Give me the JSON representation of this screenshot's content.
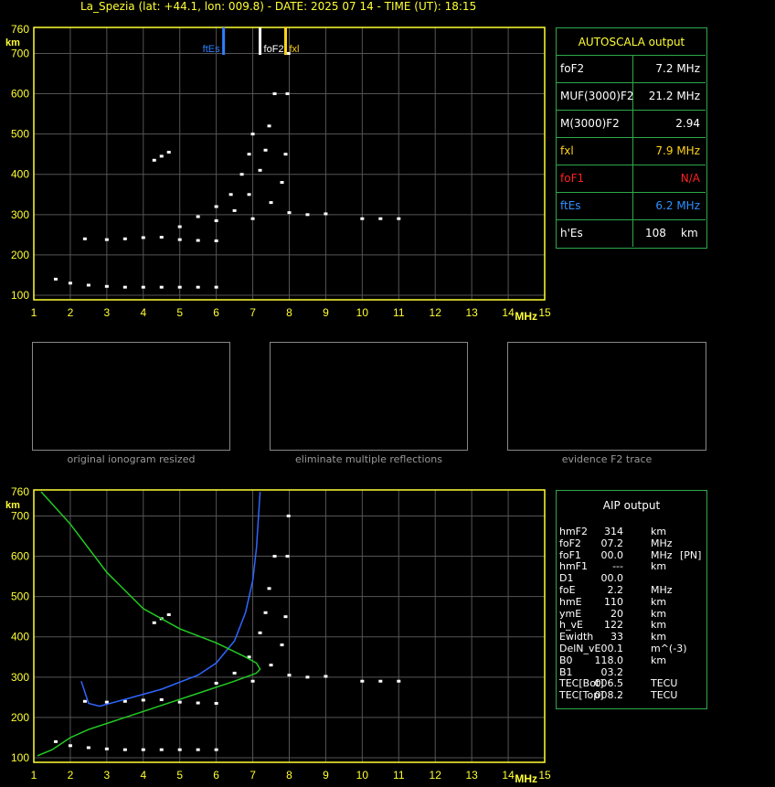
{
  "header": "La_Spezia (lat: +44.1, lon: 009.8) - DATE: 2025 07 14 - TIME (UT): 18:15",
  "chart_data": [
    {
      "type": "scatter",
      "title": "",
      "xlabel": "MHz",
      "ylabel": "km",
      "xlim": [
        1,
        15
      ],
      "ylim": [
        100,
        760
      ],
      "xticks": [
        1,
        2,
        3,
        4,
        5,
        6,
        7,
        8,
        9,
        10,
        11,
        12,
        13,
        14,
        15
      ],
      "yticks": [
        100,
        200,
        300,
        400,
        500,
        600,
        700,
        760
      ],
      "grid": true,
      "markers": [
        {
          "label": "ftEs",
          "x": 6.2,
          "color": "#2f7fff"
        },
        {
          "label": "foF2",
          "x": 7.2,
          "color": "#ffffff"
        },
        {
          "label": "fxl",
          "x": 7.9,
          "color": "#ffd21a"
        }
      ],
      "series": [
        {
          "points": [
            [
              1.6,
              140
            ],
            [
              2.0,
              130
            ],
            [
              2.5,
              125
            ],
            [
              3.0,
              122
            ],
            [
              3.5,
              120
            ],
            [
              4.0,
              120
            ],
            [
              4.5,
              120
            ],
            [
              5.0,
              120
            ],
            [
              5.5,
              120
            ],
            [
              6.0,
              120
            ]
          ]
        },
        {
          "points": [
            [
              2.4,
              240
            ],
            [
              3.0,
              238
            ],
            [
              3.5,
              240
            ],
            [
              4.0,
              243
            ],
            [
              4.5,
              244
            ],
            [
              5.0,
              238
            ],
            [
              5.5,
              236
            ],
            [
              6.0,
              235
            ]
          ]
        },
        {
          "points": [
            [
              4.3,
              435
            ],
            [
              4.5,
              445
            ],
            [
              4.7,
              455
            ]
          ]
        },
        {
          "points": [
            [
              5.0,
              270
            ],
            [
              5.5,
              295
            ],
            [
              6.0,
              320
            ],
            [
              6.4,
              350
            ],
            [
              6.7,
              400
            ],
            [
              6.9,
              450
            ],
            [
              7.0,
              500
            ]
          ]
        },
        {
          "points": [
            [
              6.0,
              285
            ],
            [
              6.5,
              310
            ],
            [
              6.9,
              350
            ],
            [
              7.2,
              410
            ],
            [
              7.35,
              460
            ],
            [
              7.45,
              520
            ],
            [
              7.6,
              600
            ]
          ]
        },
        {
          "points": [
            [
              7.0,
              290
            ],
            [
              7.5,
              330
            ],
            [
              7.8,
              380
            ],
            [
              7.9,
              450
            ],
            [
              7.95,
              600
            ],
            [
              7.98,
              700
            ]
          ]
        },
        {
          "points": [
            [
              8.0,
              305
            ],
            [
              8.5,
              300
            ],
            [
              9.0,
              302
            ],
            [
              10.0,
              290
            ],
            [
              10.5,
              290
            ],
            [
              11.0,
              290
            ]
          ]
        }
      ]
    },
    {
      "type": "scatter",
      "title": "",
      "xlabel": "MHz",
      "ylabel": "km",
      "xlim": [
        1,
        15
      ],
      "ylim": [
        100,
        760
      ],
      "xticks": [
        1,
        2,
        3,
        4,
        5,
        6,
        7,
        8,
        9,
        10,
        11,
        12,
        13,
        14,
        15
      ],
      "yticks": [
        100,
        200,
        300,
        400,
        500,
        600,
        700,
        760
      ],
      "grid": true,
      "series": [
        {
          "points": [
            [
              1.6,
              140
            ],
            [
              2.0,
              130
            ],
            [
              2.5,
              125
            ],
            [
              3.0,
              122
            ],
            [
              3.5,
              120
            ],
            [
              4.0,
              120
            ],
            [
              4.5,
              120
            ],
            [
              5.0,
              120
            ],
            [
              5.5,
              120
            ],
            [
              6.0,
              120
            ]
          ]
        },
        {
          "points": [
            [
              2.4,
              240
            ],
            [
              3.0,
              238
            ],
            [
              3.5,
              240
            ],
            [
              4.0,
              243
            ],
            [
              4.5,
              244
            ],
            [
              5.0,
              238
            ],
            [
              5.5,
              236
            ],
            [
              6.0,
              235
            ]
          ]
        },
        {
          "points": [
            [
              4.3,
              435
            ],
            [
              4.5,
              445
            ],
            [
              4.7,
              455
            ]
          ]
        },
        {
          "points": [
            [
              6.0,
              285
            ],
            [
              6.5,
              310
            ],
            [
              6.9,
              350
            ],
            [
              7.2,
              410
            ],
            [
              7.35,
              460
            ],
            [
              7.45,
              520
            ],
            [
              7.6,
              600
            ]
          ]
        },
        {
          "points": [
            [
              7.0,
              290
            ],
            [
              7.5,
              330
            ],
            [
              7.8,
              380
            ],
            [
              7.9,
              450
            ],
            [
              7.95,
              600
            ],
            [
              7.98,
              700
            ]
          ]
        },
        {
          "points": [
            [
              8.0,
              305
            ],
            [
              8.5,
              300
            ],
            [
              9.0,
              302
            ],
            [
              10.0,
              290
            ],
            [
              10.5,
              290
            ],
            [
              11.0,
              290
            ]
          ]
        },
        {
          "color": "#2f66ff",
          "points": [
            [
              2.3,
              290
            ],
            [
              2.5,
              235
            ],
            [
              2.8,
              228
            ],
            [
              3.5,
              245
            ],
            [
              4.5,
              270
            ],
            [
              5.5,
              305
            ],
            [
              6.0,
              335
            ],
            [
              6.5,
              390
            ],
            [
              6.8,
              460
            ],
            [
              7.0,
              540
            ],
            [
              7.1,
              620
            ],
            [
              7.2,
              760
            ]
          ]
        },
        {
          "color": "#22cc22",
          "points": [
            [
              1.1,
              105
            ],
            [
              1.5,
              120
            ],
            [
              2.0,
              150
            ],
            [
              2.5,
              170
            ],
            [
              3.5,
              200
            ],
            [
              4.5,
              230
            ],
            [
              5.5,
              260
            ],
            [
              6.5,
              290
            ],
            [
              7.1,
              310
            ],
            [
              7.2,
              320
            ],
            [
              7.1,
              335
            ],
            [
              6.8,
              350
            ],
            [
              6.0,
              385
            ],
            [
              5.0,
              420
            ],
            [
              4.0,
              470
            ],
            [
              3.0,
              560
            ],
            [
              2.0,
              680
            ],
            [
              1.2,
              760
            ]
          ]
        }
      ]
    }
  ],
  "thumbnails": [
    {
      "caption": "original ionogram resized"
    },
    {
      "caption": "eliminate multiple reflections"
    },
    {
      "caption": "evidence F2 trace"
    }
  ],
  "autoscala": {
    "title": "AUTOSCALA output",
    "rows": [
      {
        "label": "foF2",
        "value": "7.2 MHz",
        "color": "#ffffff"
      },
      {
        "label": "MUF(3000)F2",
        "value": "21.2 MHz",
        "color": "#ffffff"
      },
      {
        "label": "M(3000)F2",
        "value": "2.94",
        "color": "#ffffff"
      },
      {
        "label": "fxl",
        "value": "7.9 MHz",
        "color": "#ffd21a"
      },
      {
        "label": "foF1",
        "value": "N/A",
        "color": "#ff2020"
      },
      {
        "label": "ftEs",
        "value": "6.2 MHz",
        "color": "#2f8fff"
      },
      {
        "label": "h'Es",
        "value": "108",
        "unit": "km",
        "color": "#ffffff"
      }
    ]
  },
  "aip": {
    "title": "AIP output",
    "rows": [
      {
        "label": "hmF2",
        "value": "314",
        "unit": "km",
        "note": ""
      },
      {
        "label": "foF2",
        "value": "07.2",
        "unit": "MHz",
        "note": ""
      },
      {
        "label": "foF1",
        "value": "00.0",
        "unit": "MHz",
        "note": "[PN]"
      },
      {
        "label": "hmF1",
        "value": "---",
        "unit": "km",
        "note": ""
      },
      {
        "label": "D1",
        "value": "00.0",
        "unit": "",
        "note": ""
      },
      {
        "label": "foE",
        "value": "2.2",
        "unit": "MHz",
        "note": ""
      },
      {
        "label": "hmE",
        "value": "110",
        "unit": "km",
        "note": ""
      },
      {
        "label": "ymE",
        "value": "20",
        "unit": "km",
        "note": ""
      },
      {
        "label": "h_vE",
        "value": "122",
        "unit": "km",
        "note": ""
      },
      {
        "label": "Ewidth",
        "value": "33",
        "unit": "km",
        "note": ""
      },
      {
        "label": "DelN_vE",
        "value": "00.1",
        "unit": "m^(-3)",
        "note": ""
      },
      {
        "label": "B0",
        "value": "118.0",
        "unit": "km",
        "note": ""
      },
      {
        "label": "B1",
        "value": "03.2",
        "unit": "",
        "note": ""
      },
      {
        "label": "TEC[Bot]",
        "value": "006.5",
        "unit": "TECU",
        "note": ""
      },
      {
        "label": "TEC[Top]",
        "value": "008.2",
        "unit": "TECU",
        "note": ""
      }
    ]
  }
}
